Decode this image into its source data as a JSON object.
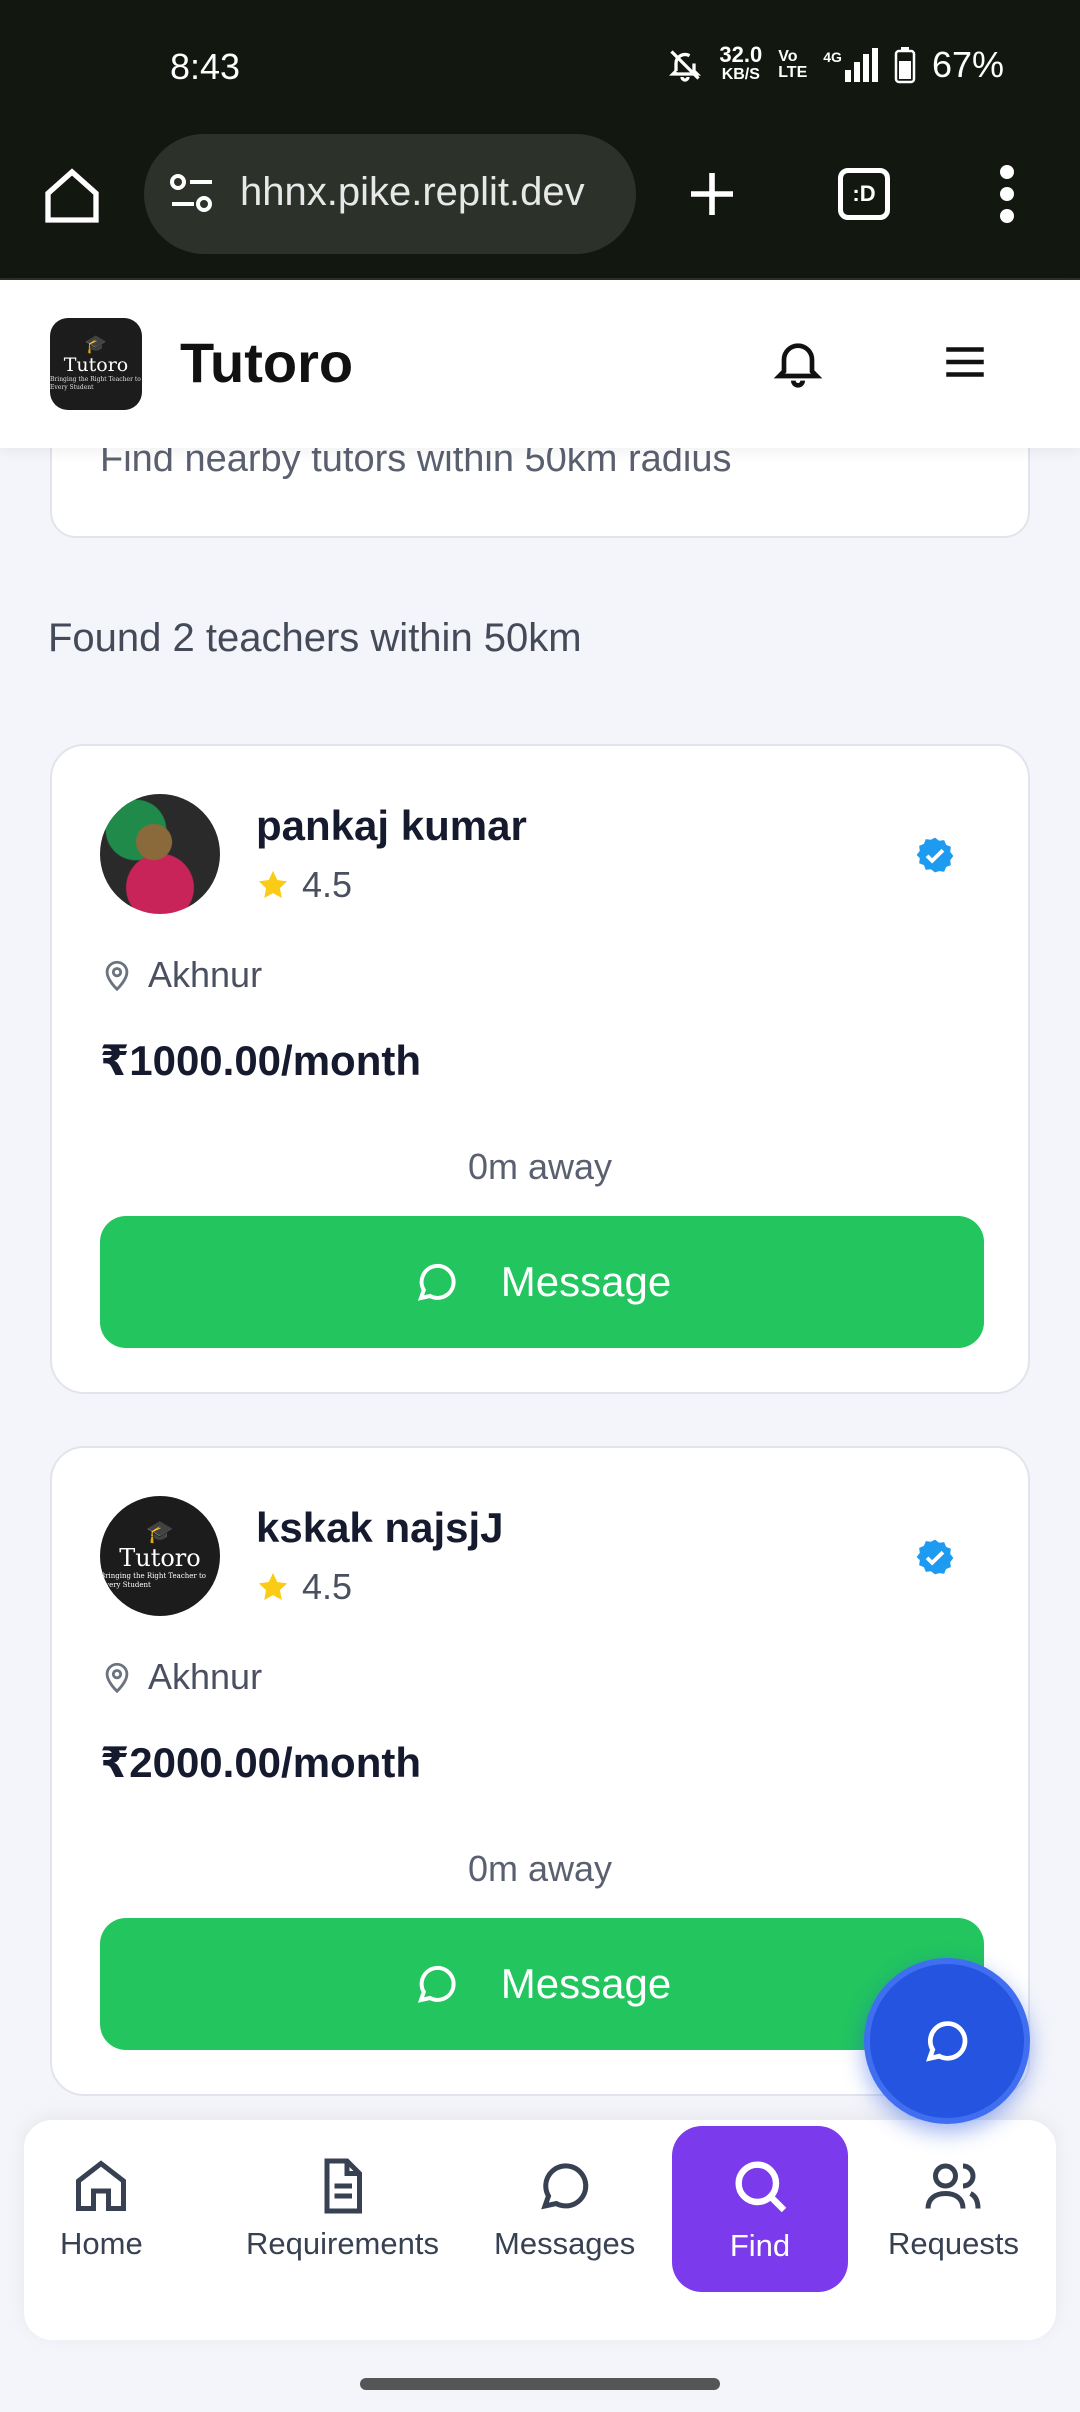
{
  "status_bar": {
    "time": "8:43",
    "speed_value": "32.0",
    "speed_unit": "KB/S",
    "volte_top": "Vo",
    "volte_bottom": "LTE",
    "network": "4G",
    "battery": "67%"
  },
  "browser": {
    "url": "hhnx.pike.replit.dev",
    "tab_label": ":D"
  },
  "header": {
    "logo_text": "Tutoro",
    "logo_tagline": "Bringing the Right Teacher to Every Student",
    "title": "Tutoro"
  },
  "search": {
    "hint": "Find nearby tutors within 50km radius"
  },
  "results": {
    "summary": "Found 2 teachers within 50km",
    "teachers": [
      {
        "name": "pankaj kumar",
        "rating": "4.5",
        "location": "Akhnur",
        "price": "₹1000.00/month",
        "distance": "0m away",
        "button_label": "Message"
      },
      {
        "name": "kskak najsjJ",
        "rating": "4.5",
        "location": "Akhnur",
        "price": "₹2000.00/month",
        "distance": "0m away",
        "button_label": "Message"
      }
    ]
  },
  "bottom_nav": {
    "items": [
      {
        "label": "Home",
        "icon": "home-icon"
      },
      {
        "label": "Requirements",
        "icon": "document-icon"
      },
      {
        "label": "Messages",
        "icon": "chat-icon"
      },
      {
        "label": "Find",
        "icon": "search-icon",
        "active": true
      },
      {
        "label": "Requests",
        "icon": "users-icon"
      }
    ]
  },
  "colors": {
    "accent_green": "#22c55e",
    "active_nav": "#7c3aed",
    "fab_blue": "#2554e0",
    "verified_blue": "#1d9bf0",
    "star": "#facc15"
  }
}
